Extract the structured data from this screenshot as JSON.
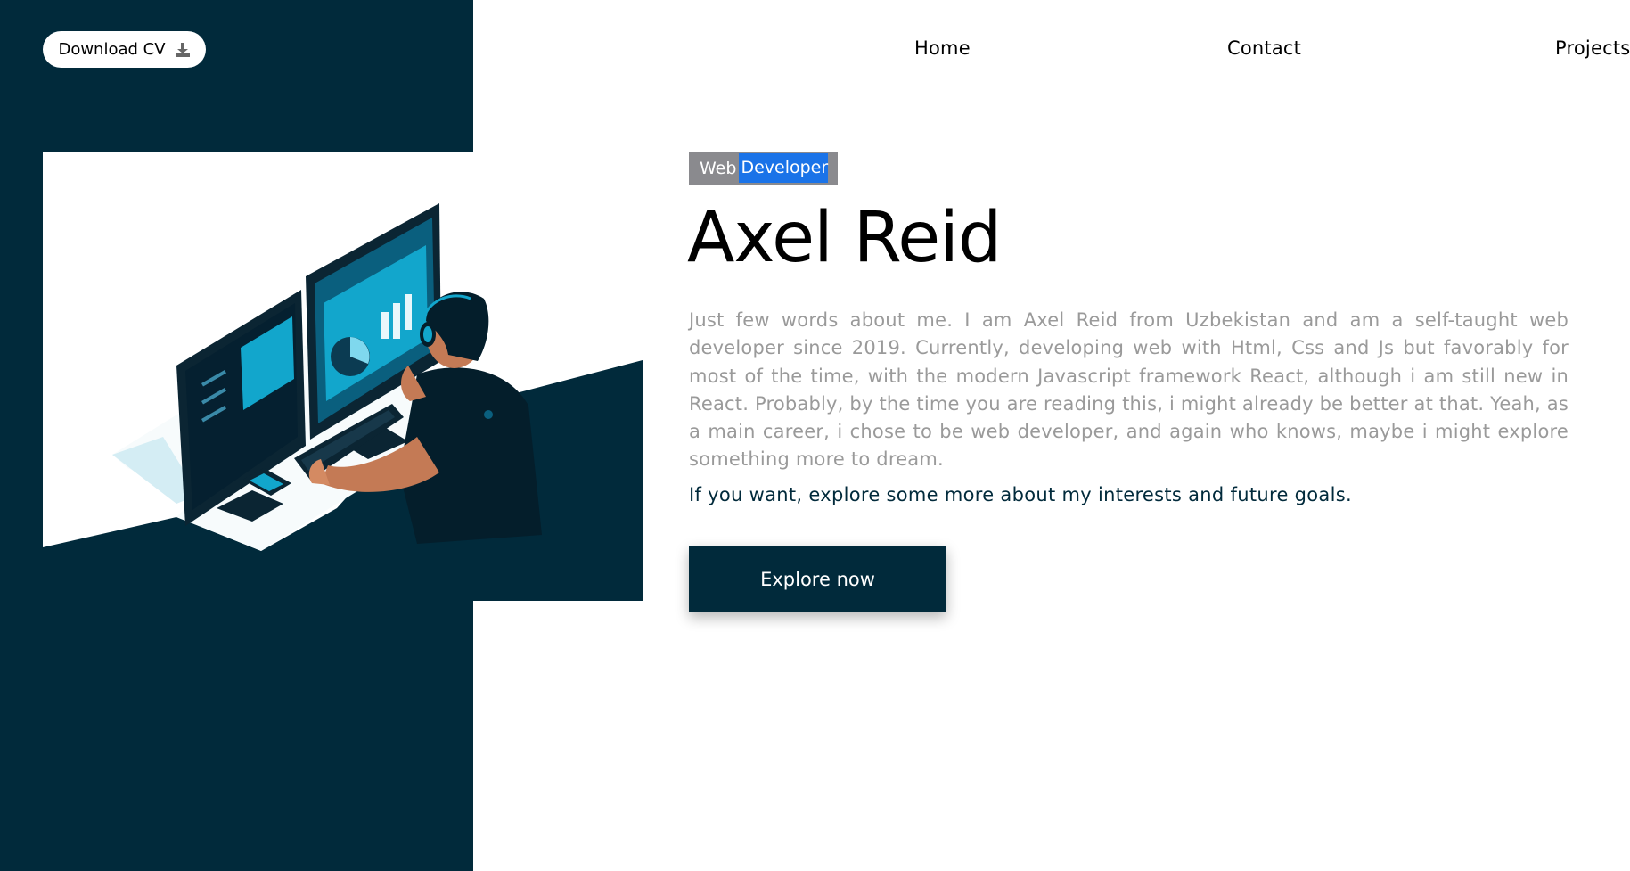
{
  "header": {
    "download_cv_label": "Download CV",
    "download_icon": "download-icon",
    "nav": [
      {
        "label": "Home"
      },
      {
        "label": "Contact"
      },
      {
        "label": "Projects"
      }
    ]
  },
  "hero": {
    "badge": {
      "prefix": "Web",
      "highlight": "Developer"
    },
    "name": "Axel Reid",
    "bio": "Just few words about me. I am Axel Reid from Uzbekistan and am a self-taught web developer since 2019. Currently, developing web with Html, Css and Js but favorably for most of the time, with the modern Javascript framework React, although i am still new in React. Probably, by the time you are reading this, i might already be better at that. Yeah, as a main career, i chose to be web developer, and again who knows, maybe i might explore something more to dream.",
    "cta_text": "If you want, explore some more about my interests and future goals.",
    "explore_button_label": "Explore now",
    "illustration": "developer-at-desk-illustration"
  },
  "colors": {
    "brand_dark": "#012a3b",
    "accent_cyan": "#12a6cc",
    "badge_bg": "#8a8a8e",
    "selection_blue": "#1a73e8",
    "bio_text": "#9a9a9a"
  }
}
